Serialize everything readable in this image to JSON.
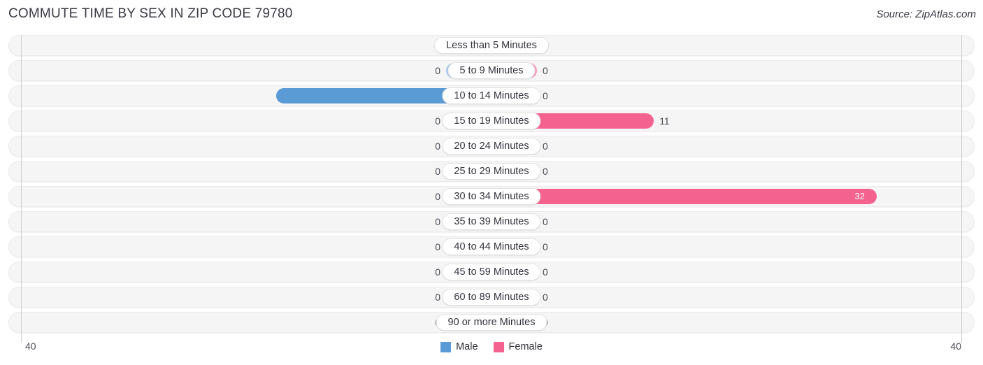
{
  "header": {
    "title": "COMMUTE TIME BY SEX IN ZIP CODE 79780",
    "source": "Source: ZipAtlas.com"
  },
  "legend": {
    "male_label": "Male",
    "female_label": "Female",
    "male_color": "#5b9bd5",
    "female_color": "#f4638f",
    "male_color_muted": "#a8c8e9",
    "female_color_muted": "#f79ab8"
  },
  "axis": {
    "left_tick": "40",
    "right_tick": "40",
    "max": 40
  },
  "chart_data": {
    "type": "bar",
    "orientation": "horizontal-diverging",
    "title": "COMMUTE TIME BY SEX IN ZIP CODE 79780",
    "xlabel": "",
    "ylabel": "",
    "xlim": [
      40,
      40
    ],
    "grid": false,
    "legend_position": "bottom-center",
    "categories": [
      "Less than 5 Minutes",
      "5 to 9 Minutes",
      "10 to 14 Minutes",
      "15 to 19 Minutes",
      "20 to 24 Minutes",
      "25 to 29 Minutes",
      "30 to 34 Minutes",
      "35 to 39 Minutes",
      "40 to 44 Minutes",
      "45 to 59 Minutes",
      "60 to 89 Minutes",
      "90 or more Minutes"
    ],
    "series": [
      {
        "name": "Male",
        "values": [
          0,
          0,
          16,
          0,
          0,
          0,
          0,
          0,
          0,
          0,
          0,
          0
        ]
      },
      {
        "name": "Female",
        "values": [
          0,
          0,
          0,
          11,
          0,
          0,
          32,
          0,
          0,
          0,
          0,
          0
        ]
      }
    ]
  },
  "rows": [
    {
      "label": "Less than 5 Minutes",
      "male": "0",
      "female": "0"
    },
    {
      "label": "5 to 9 Minutes",
      "male": "0",
      "female": "0"
    },
    {
      "label": "10 to 14 Minutes",
      "male": "16",
      "female": "0"
    },
    {
      "label": "15 to 19 Minutes",
      "male": "0",
      "female": "11"
    },
    {
      "label": "20 to 24 Minutes",
      "male": "0",
      "female": "0"
    },
    {
      "label": "25 to 29 Minutes",
      "male": "0",
      "female": "0"
    },
    {
      "label": "30 to 34 Minutes",
      "male": "0",
      "female": "32"
    },
    {
      "label": "35 to 39 Minutes",
      "male": "0",
      "female": "0"
    },
    {
      "label": "40 to 44 Minutes",
      "male": "0",
      "female": "0"
    },
    {
      "label": "45 to 59 Minutes",
      "male": "0",
      "female": "0"
    },
    {
      "label": "60 to 89 Minutes",
      "male": "0",
      "female": "0"
    },
    {
      "label": "90 or more Minutes",
      "male": "0",
      "female": "0"
    }
  ]
}
